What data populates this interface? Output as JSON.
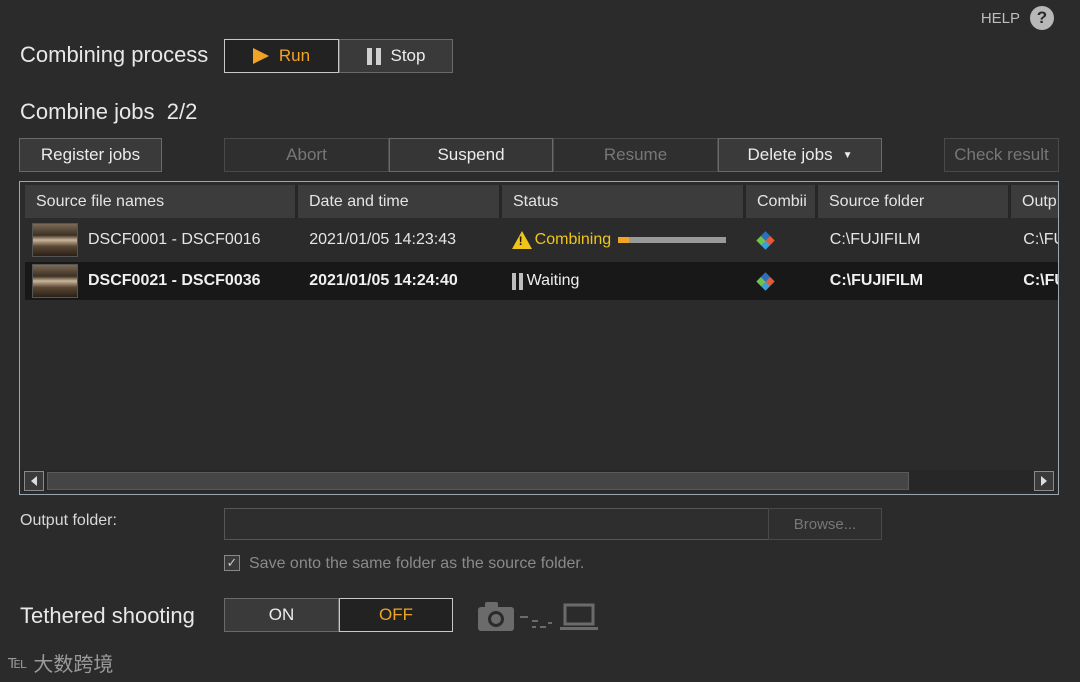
{
  "help": {
    "label": "HELP",
    "icon": "?"
  },
  "combining": {
    "title": "Combining process",
    "run_label": "Run",
    "stop_label": "Stop"
  },
  "jobs": {
    "title": "Combine jobs",
    "count": "2/2",
    "register_label": "Register jobs",
    "abort_label": "Abort",
    "suspend_label": "Suspend",
    "resume_label": "Resume",
    "delete_label": "Delete jobs",
    "check_label": "Check result"
  },
  "table": {
    "columns": [
      "Source file names",
      "Date and time",
      "Status",
      "Combii",
      "Source folder",
      "Outp"
    ],
    "rows": [
      {
        "name": "DSCF0001 - DSCF0016",
        "date": "2021/01/05 14:23:43",
        "status": "Combining",
        "progress": 0.1,
        "source": "C:\\FUJIFILM",
        "output": "C:\\FU"
      },
      {
        "name": "DSCF0021 - DSCF0036",
        "date": "2021/01/05 14:24:40",
        "status": "Waiting",
        "source": "C:\\FUJIFILM",
        "output": "C:\\FU"
      }
    ]
  },
  "output": {
    "label": "Output folder:",
    "value": "",
    "browse_label": "Browse...",
    "same_folder_label": "Save onto the same folder as the source folder.",
    "same_folder_checked": true
  },
  "tethered": {
    "title": "Tethered shooting",
    "on_label": "ON",
    "off_label": "OFF"
  },
  "watermark": "大数跨境",
  "colors": {
    "accent": "#f1a325",
    "background": "#2b2b2b"
  }
}
